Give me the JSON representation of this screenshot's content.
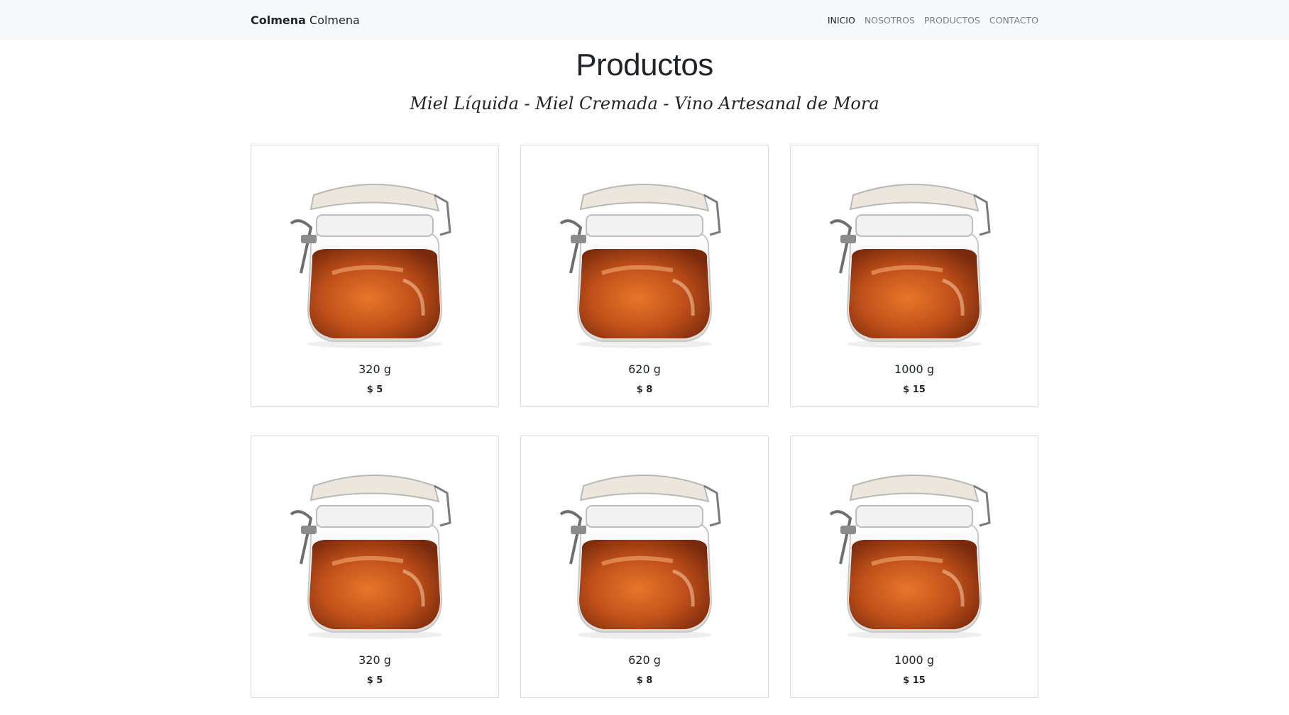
{
  "nav": {
    "brand_bold": "Colmena",
    "brand_rest": " Colmena",
    "links": [
      "INICIO",
      "NOSOTROS",
      "PRODUCTOS",
      "CONTACTO"
    ]
  },
  "page": {
    "title": "Productos",
    "subtitle": "Miel Líquida - Miel Cremada - Vino Artesanal de Mora"
  },
  "products": [
    {
      "weight": "320 g",
      "price": "$ 5",
      "image": "honey-jar"
    },
    {
      "weight": "620 g",
      "price": "$ 8",
      "image": "honey-jar"
    },
    {
      "weight": "1000 g",
      "price": "$ 15",
      "image": "honey-jar"
    },
    {
      "weight": "320 g",
      "price": "$ 5",
      "image": "honey-jar"
    },
    {
      "weight": "620 g",
      "price": "$ 8",
      "image": "honey-jar"
    },
    {
      "weight": "1000 g",
      "price": "$ 15",
      "image": "honey-jar"
    }
  ],
  "colors": {
    "navbar_bg": "#f8f9fa",
    "honey": "#c0501a",
    "text": "#212529"
  }
}
